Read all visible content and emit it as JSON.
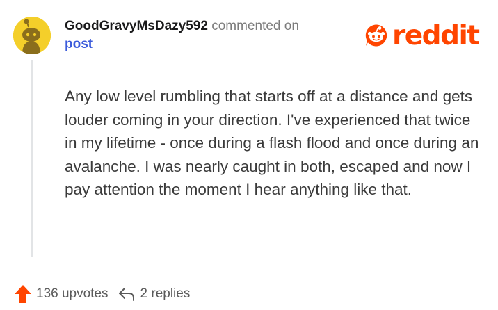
{
  "comment": {
    "username": "GoodGravyMsDazy592",
    "action_text": "commented on",
    "target_text": "post",
    "body": "Any low level rumbling that starts off at a distance and gets louder coming in your direction. I've experienced that twice in my lifetime - once during a flash flood and once during an avalanche. I was nearly caught in both, escaped and now I pay attention the moment I hear anything like that.",
    "upvotes_label": "136 upvotes",
    "replies_label": "2 replies"
  },
  "brand": {
    "logo_text": "reddit",
    "icons": [
      "avatar",
      "reddit-snoo-icon",
      "upvote-arrow-icon",
      "reply-arrow-icon"
    ]
  },
  "colors": {
    "brand": "#ff4500",
    "link": "#3b5bdb",
    "avatar_bg": "#f4cf2a",
    "text": "#3a3a3a",
    "muted": "#7c7c7c"
  }
}
